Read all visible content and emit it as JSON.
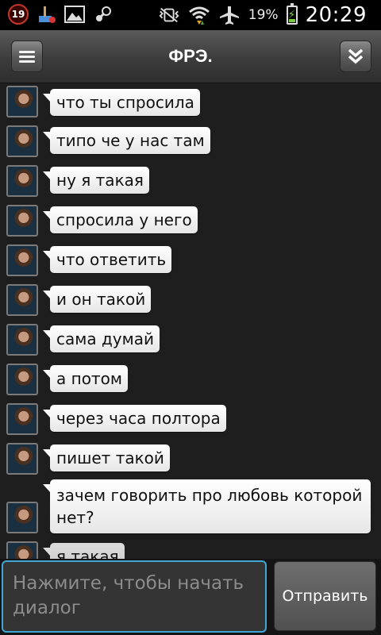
{
  "status_bar": {
    "notification_count": "19",
    "battery_percent": "19%",
    "time": "20:29",
    "icons": [
      "notification-badge-icon",
      "broom-icon",
      "image-icon",
      "steam-icon",
      "vibrate-icon",
      "wifi-icon",
      "airplane-icon",
      "battery-charging-icon"
    ]
  },
  "header": {
    "title": "ФРЭ."
  },
  "messages": [
    {
      "text": "что ты спросила"
    },
    {
      "text": "типо че у нас там"
    },
    {
      "text": "ну я такая"
    },
    {
      "text": "спросила у него"
    },
    {
      "text": "что ответить"
    },
    {
      "text": "и он такой"
    },
    {
      "text": "сама думай"
    },
    {
      "text": "а потом"
    },
    {
      "text": "через часа полтора"
    },
    {
      "text": "пишет такой"
    },
    {
      "text": "зачем говорить про любовь которой нет?"
    },
    {
      "text": "я такая"
    }
  ],
  "composer": {
    "placeholder": "Нажмите, чтобы начать диалог",
    "send_label": "Отправить"
  }
}
